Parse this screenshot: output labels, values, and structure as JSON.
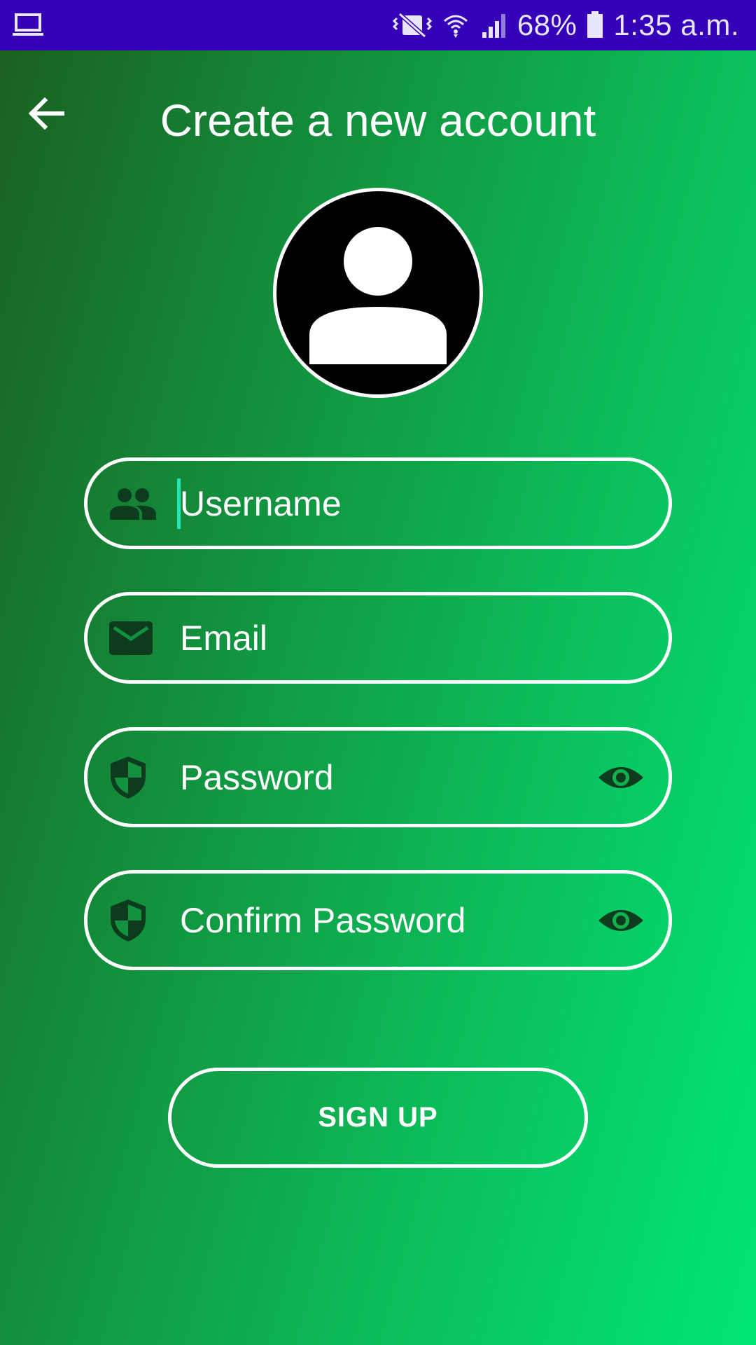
{
  "status_bar": {
    "battery_percent": "68%",
    "time": "1:35 a.m.",
    "icons": [
      "laptop-icon",
      "vibrate-mute-icon",
      "wifi-icon",
      "cell-signal-icon",
      "battery-icon"
    ],
    "background": "#3500b8"
  },
  "header": {
    "title": "Create a new account",
    "back_icon": "arrow-back-icon"
  },
  "avatar": {
    "icon": "person-avatar-icon"
  },
  "form": {
    "username": {
      "placeholder": "Username",
      "icon": "group-icon",
      "focused": true
    },
    "email": {
      "placeholder": "Email",
      "icon": "email-icon"
    },
    "password": {
      "placeholder": "Password",
      "icon": "shield-icon",
      "toggle_icon": "eye-icon"
    },
    "confirm_password": {
      "placeholder": "Confirm Password",
      "icon": "shield-icon",
      "toggle_icon": "eye-icon"
    }
  },
  "signup_button": {
    "label": "SIGN UP"
  },
  "colors": {
    "gradient_start": "#1b5e20",
    "gradient_end": "#00e676",
    "icon_dark": "#0d3b1e",
    "caret": "#1de9b6"
  }
}
